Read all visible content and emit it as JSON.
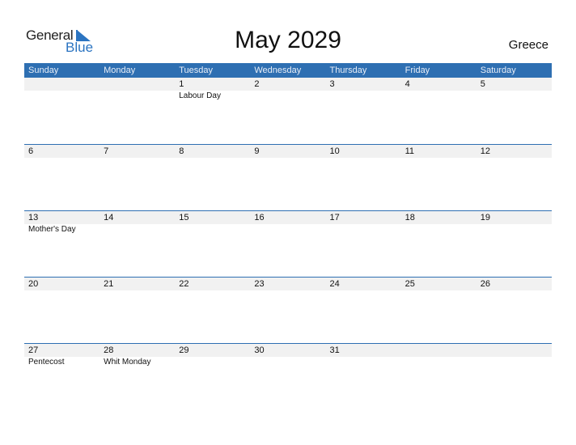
{
  "logo": {
    "line1": "General",
    "line2": "Blue",
    "icon": "triangle-flag-icon"
  },
  "title": "May 2029",
  "country": "Greece",
  "colors": {
    "accent": "#2e6fb2",
    "strip": "#f1f1f1",
    "logo_blue": "#2b74c1"
  },
  "weekdays": [
    "Sunday",
    "Monday",
    "Tuesday",
    "Wednesday",
    "Thursday",
    "Friday",
    "Saturday"
  ],
  "weeks": [
    [
      {
        "d": "",
        "e": ""
      },
      {
        "d": "",
        "e": ""
      },
      {
        "d": "1",
        "e": "Labour Day"
      },
      {
        "d": "2",
        "e": ""
      },
      {
        "d": "3",
        "e": ""
      },
      {
        "d": "4",
        "e": ""
      },
      {
        "d": "5",
        "e": ""
      }
    ],
    [
      {
        "d": "6",
        "e": ""
      },
      {
        "d": "7",
        "e": ""
      },
      {
        "d": "8",
        "e": ""
      },
      {
        "d": "9",
        "e": ""
      },
      {
        "d": "10",
        "e": ""
      },
      {
        "d": "11",
        "e": ""
      },
      {
        "d": "12",
        "e": ""
      }
    ],
    [
      {
        "d": "13",
        "e": "Mother's Day"
      },
      {
        "d": "14",
        "e": ""
      },
      {
        "d": "15",
        "e": ""
      },
      {
        "d": "16",
        "e": ""
      },
      {
        "d": "17",
        "e": ""
      },
      {
        "d": "18",
        "e": ""
      },
      {
        "d": "19",
        "e": ""
      }
    ],
    [
      {
        "d": "20",
        "e": ""
      },
      {
        "d": "21",
        "e": ""
      },
      {
        "d": "22",
        "e": ""
      },
      {
        "d": "23",
        "e": ""
      },
      {
        "d": "24",
        "e": ""
      },
      {
        "d": "25",
        "e": ""
      },
      {
        "d": "26",
        "e": ""
      }
    ],
    [
      {
        "d": "27",
        "e": "Pentecost"
      },
      {
        "d": "28",
        "e": "Whit Monday"
      },
      {
        "d": "29",
        "e": ""
      },
      {
        "d": "30",
        "e": ""
      },
      {
        "d": "31",
        "e": ""
      },
      {
        "d": "",
        "e": ""
      },
      {
        "d": "",
        "e": ""
      }
    ]
  ]
}
